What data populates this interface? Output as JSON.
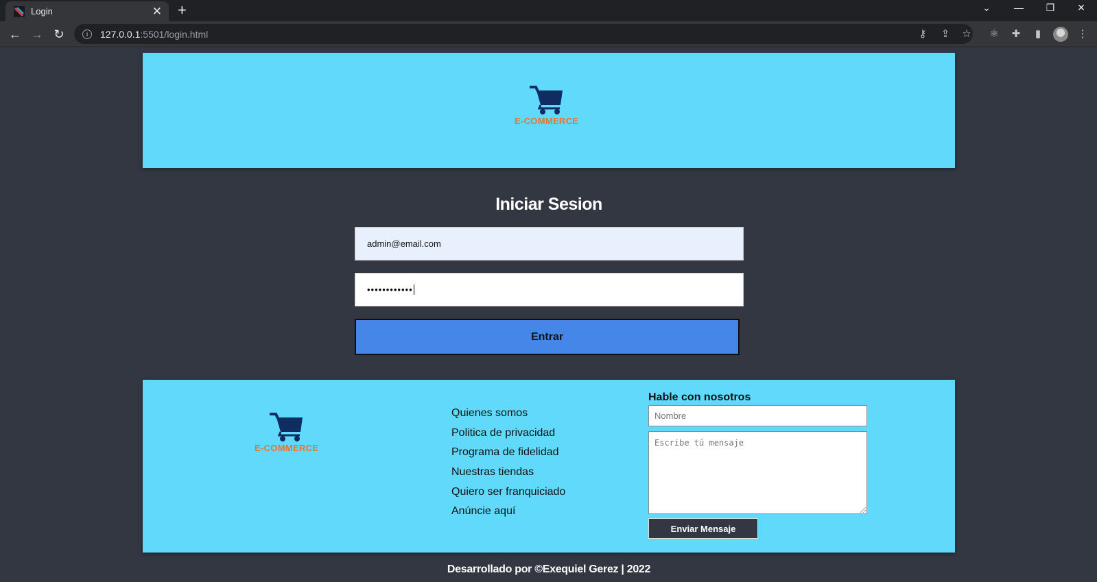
{
  "browser": {
    "tab_title": "Login",
    "tab_close": "✕",
    "new_tab": "+",
    "url_host": "127.0.0.1",
    "url_rest": ":5501/login.html"
  },
  "header": {
    "brand": "E-COMMERCE"
  },
  "login": {
    "title": "Iniciar Sesion",
    "email_value": "admin@email.com",
    "password_mask": "••••••••••••",
    "submit_label": "Entrar"
  },
  "footer": {
    "brand": "E-COMMERCE",
    "links": [
      "Quienes somos",
      "Politica de privacidad",
      "Programa de fidelidad",
      "Nuestras tiendas",
      "Quiero ser franquiciado",
      "Anúncie aquí"
    ],
    "contact_heading": "Hable con nosotros",
    "name_placeholder": "Nombre",
    "message_placeholder": "Escribe tú mensaje",
    "send_label": "Enviar Mensaje"
  },
  "credits": "Desarrollado por ©Exequiel Gerez | 2022",
  "colors": {
    "page_bg": "#323741",
    "panel_bg": "#61d9fb",
    "button_blue": "#4587e8",
    "brand_orange": "#e8752f",
    "cart_navy": "#0f2c63"
  }
}
